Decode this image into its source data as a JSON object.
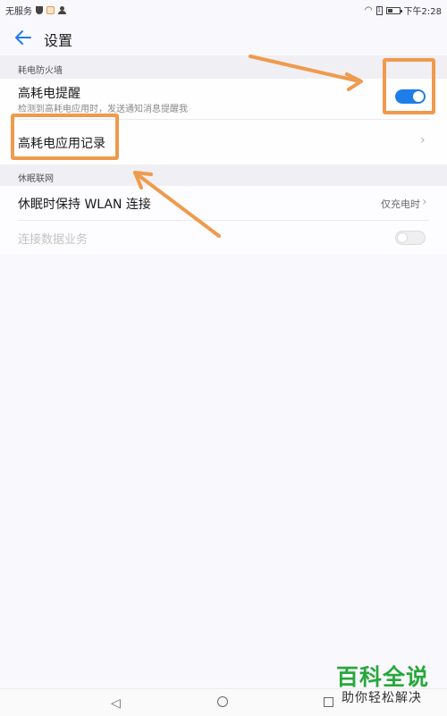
{
  "status_bar": {
    "carrier": "无服务",
    "time": "下午2:28",
    "sim_label": "1"
  },
  "header": {
    "title": "设置"
  },
  "sections": [
    {
      "header": "耗电防火墙",
      "items": [
        {
          "title": "高耗电提醒",
          "subtitle": "检测到高耗电应用时，发送通知消息提醒我",
          "toggle_on": true
        },
        {
          "title": "高耗电应用记录"
        }
      ]
    },
    {
      "header": "休眠联网",
      "items": [
        {
          "title": "休眠时保持 WLAN 连接",
          "value": "仅充电时"
        },
        {
          "title": "连接数据业务",
          "toggle_on": false,
          "disabled": true
        }
      ]
    }
  ],
  "annotation": {
    "color": "#ef9a4d"
  },
  "watermark": {
    "title": "百科全说",
    "subtitle": "助你轻松解决"
  },
  "icons": [
    "back-arrow-icon",
    "chevron-right-icon",
    "shield-icon",
    "person-icon",
    "wifi-icon",
    "battery-icon",
    "nav-back-icon",
    "nav-home-icon",
    "nav-recent-icon"
  ],
  "colors": {
    "accent": "#1e7ee8",
    "annotation": "#ef9a4d",
    "watermark_green": "#27a83b"
  }
}
